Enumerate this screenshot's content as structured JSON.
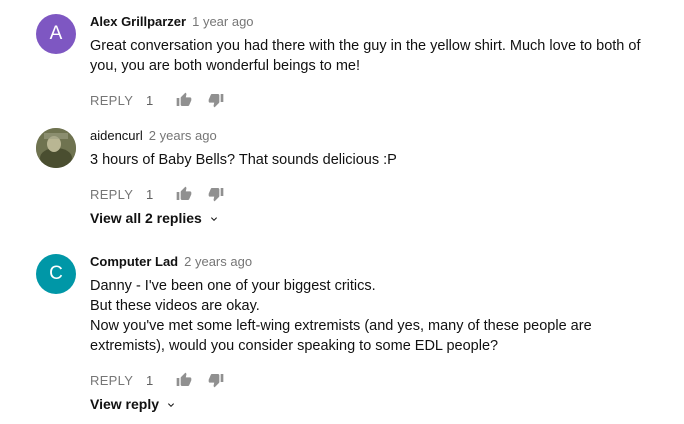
{
  "comments": [
    {
      "author": "Alex Grillparzer",
      "time": "1 year ago",
      "avatar_letter": "A",
      "avatar_color": "#7e57c2",
      "lines": [
        "Great conversation you had there with the guy in the yellow shirt. Much love to both of",
        "you, you are both wonderful beings to me!"
      ],
      "reply_label": "REPLY",
      "likes": "1"
    },
    {
      "author": "aidencurl",
      "time": "2 years ago",
      "lines": [
        "3 hours of Baby Bells? That sounds delicious :P"
      ],
      "reply_label": "REPLY",
      "likes": "1"
    },
    {
      "author": "Computer Lad",
      "time": "2 years ago",
      "avatar_letter": "C",
      "avatar_color": "#0097a7",
      "lines": [
        "Danny - I've been one of your biggest critics.",
        "But these videos are okay.",
        "Now you've met some left-wing extremists (and yes, many of these people are",
        "extremists), would you consider speaking to some EDL people?"
      ],
      "reply_label": "REPLY",
      "likes": "1"
    }
  ],
  "view_replies": {
    "view_all": "View all 2 replies",
    "view_one": "View reply"
  },
  "icons": {
    "like": "thumbs-up-icon",
    "dislike": "thumbs-down-icon",
    "chevron": "chevron-down-icon"
  }
}
